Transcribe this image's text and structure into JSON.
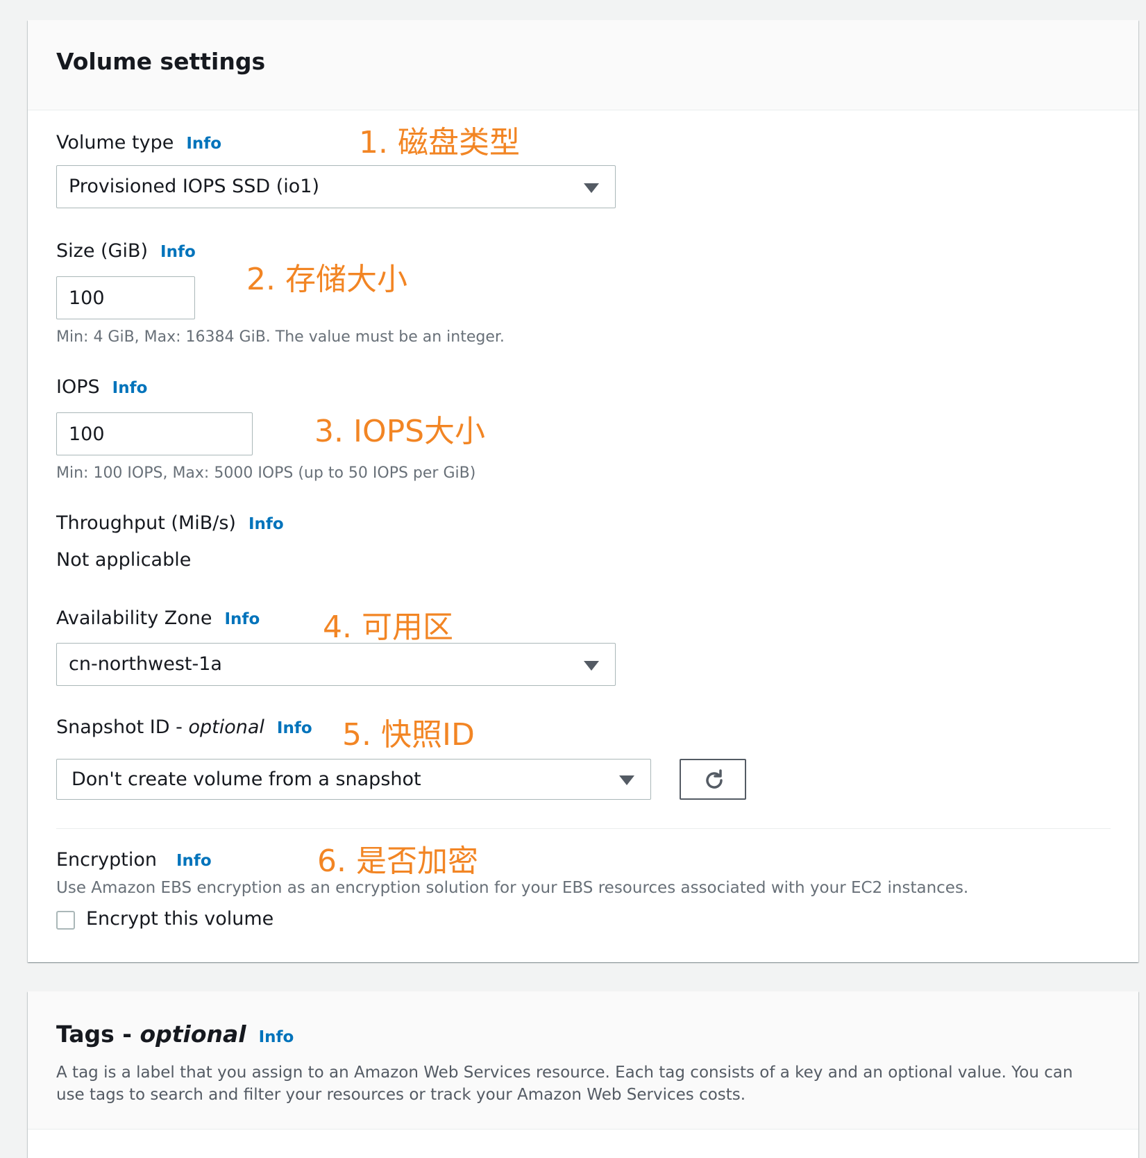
{
  "volume_settings": {
    "title": "Volume settings",
    "volume_type": {
      "label": "Volume type",
      "info": "Info",
      "value": "Provisioned IOPS SSD (io1)",
      "annotation": "1.  磁盘类型"
    },
    "size": {
      "label": "Size (GiB)",
      "info": "Info",
      "value": "100",
      "hint": "Min: 4 GiB, Max: 16384 GiB. The value must be an integer.",
      "annotation": "2.  存储大小"
    },
    "iops": {
      "label": "IOPS",
      "info": "Info",
      "value": "100",
      "hint": "Min: 100 IOPS, Max: 5000 IOPS (up to 50 IOPS per GiB)",
      "annotation": "3. IOPS大小"
    },
    "throughput": {
      "label": "Throughput (MiB/s)",
      "info": "Info",
      "value": "Not applicable"
    },
    "availability_zone": {
      "label": "Availability Zone",
      "info": "Info",
      "value": "cn-northwest-1a",
      "annotation": "4. 可用区"
    },
    "snapshot": {
      "label": "Snapshot ID - ",
      "label_optional": "optional",
      "info": "Info",
      "value": "Don't create volume from a snapshot",
      "annotation": "5. 快照ID",
      "refresh_icon": "refresh-icon"
    },
    "encryption": {
      "label": "Encryption",
      "info": "Info",
      "description": "Use Amazon EBS encryption as an encryption solution for your EBS resources associated with your EC2 instances.",
      "checkbox_label": "Encrypt this volume",
      "checked": false,
      "annotation": "6. 是否加密"
    }
  },
  "tags": {
    "title": "Tags - ",
    "title_optional": "optional",
    "info": "Info",
    "description": "A tag is a label that you assign to an Amazon Web Services resource. Each tag consists of a key and an optional value. You can use tags to search and filter your resources or track your Amazon Web Services costs."
  },
  "colors": {
    "link": "#0073bb",
    "annotation": "#f28524",
    "hint": "#687078",
    "border": "#aab7b8",
    "background": "#f2f3f3"
  }
}
